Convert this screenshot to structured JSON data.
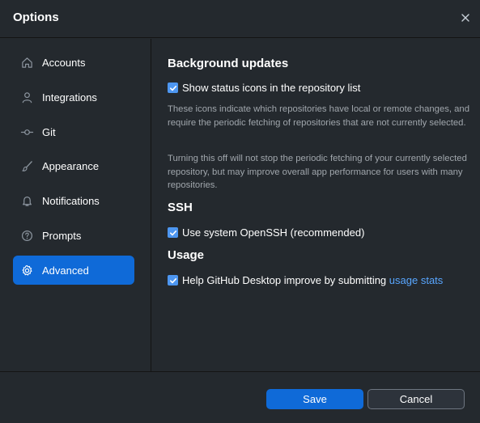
{
  "dialog": {
    "title": "Options"
  },
  "sidebar": {
    "items": [
      {
        "label": "Accounts",
        "icon": "home-icon"
      },
      {
        "label": "Integrations",
        "icon": "person-icon"
      },
      {
        "label": "Git",
        "icon": "git-commit-icon"
      },
      {
        "label": "Appearance",
        "icon": "paintbrush-icon"
      },
      {
        "label": "Notifications",
        "icon": "bell-icon"
      },
      {
        "label": "Prompts",
        "icon": "question-icon"
      },
      {
        "label": "Advanced",
        "icon": "gear-icon",
        "active": true
      }
    ]
  },
  "advanced": {
    "background_updates": {
      "heading": "Background updates",
      "checkbox_label": "Show status icons in the repository list",
      "checked": true,
      "description_1": "These icons indicate which repositories have local or remote changes, and require the periodic fetching of repositories that are not currently selected.",
      "description_2": "Turning this off will not stop the periodic fetching of your currently selected repository, but may improve overall app performance for users with many repositories."
    },
    "ssh": {
      "heading": "SSH",
      "checkbox_label": "Use system OpenSSH (recommended)",
      "checked": true
    },
    "usage": {
      "heading": "Usage",
      "checkbox_label": "Help GitHub Desktop improve by submitting",
      "link_text": "usage stats",
      "checked": true
    }
  },
  "footer": {
    "save_label": "Save",
    "cancel_label": "Cancel"
  },
  "colors": {
    "accent": "#0f6ad8",
    "link": "#58a6ff",
    "background": "#24292e",
    "checkbox": "#4d96f0"
  }
}
